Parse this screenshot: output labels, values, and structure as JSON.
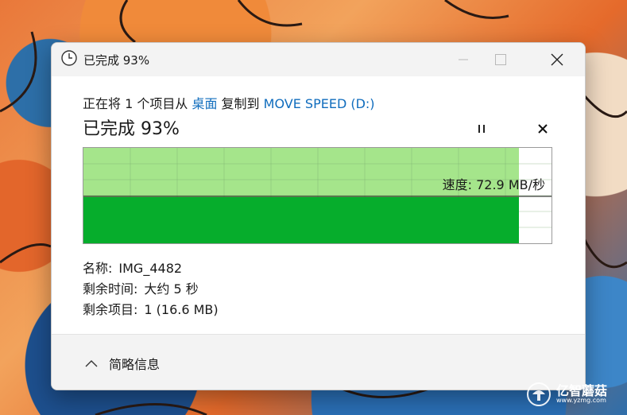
{
  "window": {
    "title": "已完成 93%"
  },
  "copy": {
    "prefix": "正在将 1 个项目从 ",
    "source": "桌面",
    "middle": " 复制到 ",
    "destination": "MOVE SPEED (D:)",
    "progress_text": "已完成 93%",
    "progress_percent": 93,
    "speed_text": "速度: 72.9 MB/秒"
  },
  "details": {
    "name_label": "名称:",
    "name_value": "IMG_4482",
    "time_label": "剩余时间:",
    "time_value": "大约 5 秒",
    "items_label": "剩余项目:",
    "items_value": "1 (16.6 MB)"
  },
  "footer": {
    "toggle_label": "简略信息"
  },
  "watermark": {
    "brand": "亿智蘑菇",
    "url": "www.yzmg.com"
  },
  "colors": {
    "accent": "#0f6cbd",
    "graph_fill": "#06ad2c",
    "graph_progress": "#a5e58b"
  }
}
